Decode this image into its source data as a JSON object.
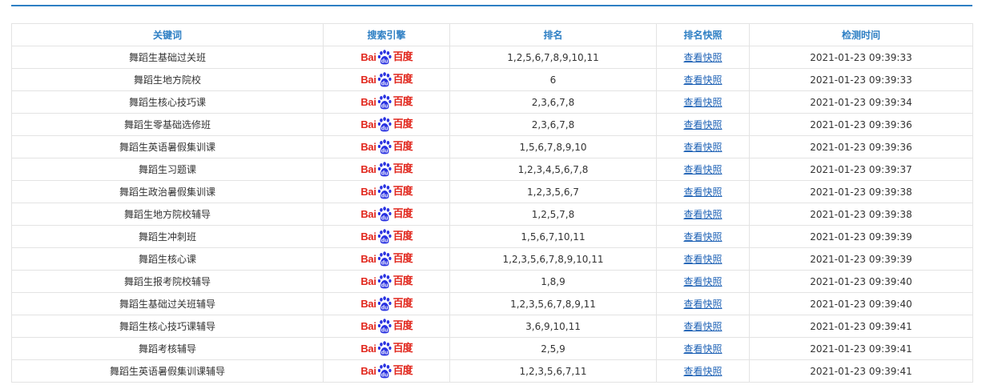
{
  "table": {
    "headers": {
      "keyword": "关键词",
      "engine": "搜索引擎",
      "rank": "排名",
      "snapshot": "排名快照",
      "time": "检测时间"
    },
    "engine_logo": {
      "text_left": "Bai",
      "text_right": "百度",
      "icon": "baidu-paw-icon",
      "color": "#e1251b",
      "paw_color": "#2932e1"
    },
    "snapshot_label": "查看快照",
    "accent_color": "#2e7fc4",
    "rows": [
      {
        "keyword": "舞蹈生基础过关班",
        "rank": "1,2,5,6,7,8,9,10,11",
        "time": "2021-01-23 09:39:33"
      },
      {
        "keyword": "舞蹈生地方院校",
        "rank": "6",
        "time": "2021-01-23 09:39:33"
      },
      {
        "keyword": "舞蹈生核心技巧课",
        "rank": "2,3,6,7,8",
        "time": "2021-01-23 09:39:34"
      },
      {
        "keyword": "舞蹈生零基础选修班",
        "rank": "2,3,6,7,8",
        "time": "2021-01-23 09:39:36"
      },
      {
        "keyword": "舞蹈生英语暑假集训课",
        "rank": "1,5,6,7,8,9,10",
        "time": "2021-01-23 09:39:36"
      },
      {
        "keyword": "舞蹈生习题课",
        "rank": "1,2,3,4,5,6,7,8",
        "time": "2021-01-23 09:39:37"
      },
      {
        "keyword": "舞蹈生政治暑假集训课",
        "rank": "1,2,3,5,6,7",
        "time": "2021-01-23 09:39:38"
      },
      {
        "keyword": "舞蹈生地方院校辅导",
        "rank": "1,2,5,7,8",
        "time": "2021-01-23 09:39:38"
      },
      {
        "keyword": "舞蹈生冲刺班",
        "rank": "1,5,6,7,10,11",
        "time": "2021-01-23 09:39:39"
      },
      {
        "keyword": "舞蹈生核心课",
        "rank": "1,2,3,5,6,7,8,9,10,11",
        "time": "2021-01-23 09:39:39"
      },
      {
        "keyword": "舞蹈生报考院校辅导",
        "rank": "1,8,9",
        "time": "2021-01-23 09:39:40"
      },
      {
        "keyword": "舞蹈生基础过关班辅导",
        "rank": "1,2,3,5,6,7,8,9,11",
        "time": "2021-01-23 09:39:40"
      },
      {
        "keyword": "舞蹈生核心技巧课辅导",
        "rank": "3,6,9,10,11",
        "time": "2021-01-23 09:39:41"
      },
      {
        "keyword": "舞蹈考核辅导",
        "rank": "2,5,9",
        "time": "2021-01-23 09:39:41"
      },
      {
        "keyword": "舞蹈生英语暑假集训课辅导",
        "rank": "1,2,3,5,6,7,11",
        "time": "2021-01-23 09:39:41"
      }
    ]
  }
}
